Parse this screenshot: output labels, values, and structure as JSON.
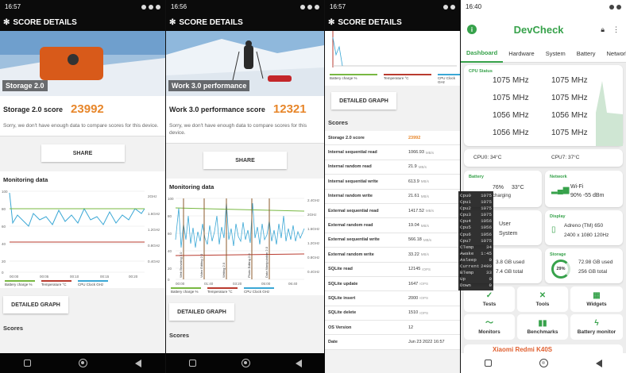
{
  "panels": [
    {
      "time": "16:57",
      "title": "SCORE DETAILS",
      "hero_label": "Storage 2.0",
      "score_label": "Storage 2.0 score",
      "score": "23992",
      "note": "Sorry, we don't have enough data to compare scores for this device.",
      "share": "SHARE",
      "monitoring": "Monitoring data",
      "left_ticks": [
        "100",
        "80",
        "60",
        "40",
        "20",
        "0"
      ],
      "right_ticks": [
        "2GHz",
        "1.6GHz",
        "1.2GHz",
        "0.8GHz",
        "0.4GHz"
      ],
      "x_ticks": [
        "00:00",
        "00:05",
        "00:10",
        "00:15",
        "00:20"
      ],
      "legend": [
        "Battery charge %",
        "Temperature °C",
        "CPU Clock GHz"
      ],
      "detailed": "DETAILED GRAPH",
      "scores": "Scores"
    },
    {
      "time": "16:56",
      "title": "SCORE DETAILS",
      "hero_label": "Work 3.0 performance",
      "score_label": "Work 3.0 performance score",
      "score": "12321",
      "note": "Sorry, we don't have enough data to compare scores for this device.",
      "share": "SHARE",
      "monitoring": "Monitoring data",
      "left_ticks": [
        "100",
        "80",
        "60",
        "40",
        "20",
        "0"
      ],
      "right_ticks": [
        "2.4GHz",
        "2GHz",
        "1.6GHz",
        "1.2GHz",
        "0.8GHz",
        "0.4GHz"
      ],
      "x_ticks": [
        "00:00",
        "01:40",
        "03:20",
        "05:00",
        "06:40"
      ],
      "markers": [
        "Web Browsing 2.0",
        "Video Editing 2.0",
        "Writing 2.0",
        "Photo Editing 2.0",
        "Data Manipulation 2.0"
      ],
      "legend": [
        "Battery charge %",
        "Temperature °C",
        "CPU Clock GHz"
      ],
      "detailed": "DETAILED GRAPH",
      "scores": "Scores"
    }
  ],
  "panel3": {
    "time": "16:57",
    "title": "SCORE DETAILS",
    "legend": [
      "Battery charge %",
      "Temperature °C",
      "CPU Clock GHz"
    ],
    "detailed": "DETAILED GRAPH",
    "scores": "Scores",
    "rows": [
      {
        "k": "Storage 2.0 score",
        "v": "23992",
        "u": "",
        "accent": true
      },
      {
        "k": "Internal sequential read",
        "v": "1066.93",
        "u": "MB/s"
      },
      {
        "k": "Internal random read",
        "v": "21.9",
        "u": "MB/s"
      },
      {
        "k": "Internal sequential write",
        "v": "613.9",
        "u": "MB/s"
      },
      {
        "k": "Internal random write",
        "v": "21.61",
        "u": "MB/s"
      },
      {
        "k": "External sequential read",
        "v": "1417.52",
        "u": "MB/s"
      },
      {
        "k": "External random read",
        "v": "19.04",
        "u": "MB/s"
      },
      {
        "k": "External sequential write",
        "v": "566.18",
        "u": "MB/s"
      },
      {
        "k": "External random write",
        "v": "33.22",
        "u": "MB/s"
      },
      {
        "k": "SQLite read",
        "v": "12145",
        "u": "IOPS"
      },
      {
        "k": "SQLite update",
        "v": "1647",
        "u": "IOPS"
      },
      {
        "k": "SQLite insert",
        "v": "2000",
        "u": "IOPS"
      },
      {
        "k": "SQLite delete",
        "v": "1510",
        "u": "IOPS"
      },
      {
        "k": "OS Version",
        "v": "12",
        "u": ""
      },
      {
        "k": "Date",
        "v": "Jun 23 2022 16:57",
        "u": ""
      }
    ]
  },
  "devcheck": {
    "time": "16:40",
    "title": "DevCheck",
    "tabs": [
      "Dashboard",
      "Hardware",
      "System",
      "Battery",
      "Network"
    ],
    "cpu_status": "CPU Status",
    "freqs": [
      "1075 MHz",
      "1075 MHz",
      "1075 MHz",
      "1075 MHz",
      "1056 MHz",
      "1056 MHz",
      "1056 MHz",
      "1075 MHz"
    ],
    "cpu0": "CPU0: 34°C",
    "cpu7": "CPU7: 37°C",
    "battery": {
      "title": "Battery",
      "pct": "76%",
      "temp": "33°C",
      "state": "charging"
    },
    "network": {
      "title": "Network",
      "type": "Wi-Fi",
      "detail": "90%  -55 dBm"
    },
    "system": {
      "l1": "User",
      "l2": "System"
    },
    "display": {
      "title": "Display",
      "gpu": "Adreno (TM) 650",
      "res": "2400 x 1080  120Hz"
    },
    "ram": {
      "used": "3.8 GB used",
      "total": "7.4 GB total"
    },
    "storage": {
      "title": "Storage",
      "pct": "29%",
      "used": "72.98 GB used",
      "total": "256 GB total"
    },
    "tiles": [
      "Tests",
      "Tools",
      "Widgets",
      "Monitors",
      "Benchmarks",
      "Battery monitor"
    ],
    "device": "Xiaomi Redmi K40S"
  },
  "overlay": [
    [
      "Cpu0",
      "1075"
    ],
    [
      "Cpu1",
      "1075"
    ],
    [
      "Cpu2",
      "1075"
    ],
    [
      "Cpu3",
      "1075"
    ],
    [
      "Cpu4",
      "1056"
    ],
    [
      "Cpu5",
      "1056"
    ],
    [
      "Cpu6",
      "1056"
    ],
    [
      "Cpu7",
      "1075"
    ],
    [
      "CTemp",
      "34"
    ],
    [
      "Awake",
      "1:45"
    ],
    [
      "Asleep",
      "0"
    ],
    [
      "Current",
      "2490"
    ],
    [
      "BTemp",
      "33"
    ],
    [
      "Up",
      "0"
    ],
    [
      "Down",
      "0"
    ]
  ]
}
